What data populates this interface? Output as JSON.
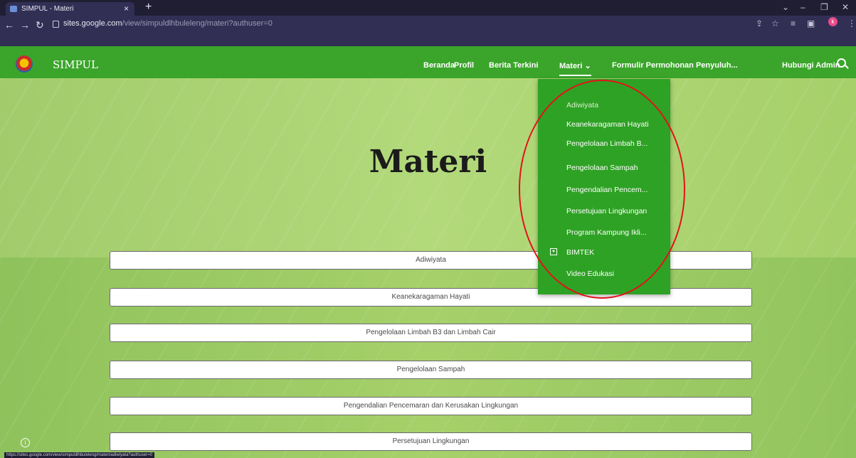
{
  "browser": {
    "tab_title": "SIMPUL - Materi",
    "tab_close": "×",
    "new_tab": "+",
    "url_host": "sites.google.com",
    "url_path": "/view/simpuldlhbuleleng/materi?authuser=0",
    "profile_initial": "k",
    "status_url": "https://sites.google.com/view/simpuldlhbuleleng/materi/adiwiyata?authuser=0"
  },
  "site": {
    "name": "SIMPUL",
    "nav": {
      "beranda": "Beranda",
      "profil": "Profil",
      "berita": "Berita Terkini",
      "materi": "Materi",
      "formulir": "Formulir Permohonan Penyuluh...",
      "hubungi": "Hubungi Admin"
    }
  },
  "hero": {
    "title": "Materi"
  },
  "dropdown": {
    "items": [
      "Adiwiyata",
      "Keanekaragaman Hayati",
      "Pengelolaan Limbah B...",
      "Pengelolaan Sampah",
      "Pengendalian Pencem...",
      "Persetujuan Lingkungan",
      "Program Kampung Ikli...",
      "BIMTEK",
      "Video Edukasi"
    ]
  },
  "buttons": [
    "Adiwiyata",
    "Keanekaragaman Hayati",
    "Pengelolaan Limbah B3 dan Limbah Cair",
    "Pengelolaan Sampah",
    "Pengendalian Pencemaran dan Kerusakan Lingkungan",
    "Persetujuan Lingkungan"
  ],
  "colors": {
    "header_green": "#3aa52a",
    "dropdown_green": "#2ea224",
    "annotation_red": "#e3121a"
  }
}
